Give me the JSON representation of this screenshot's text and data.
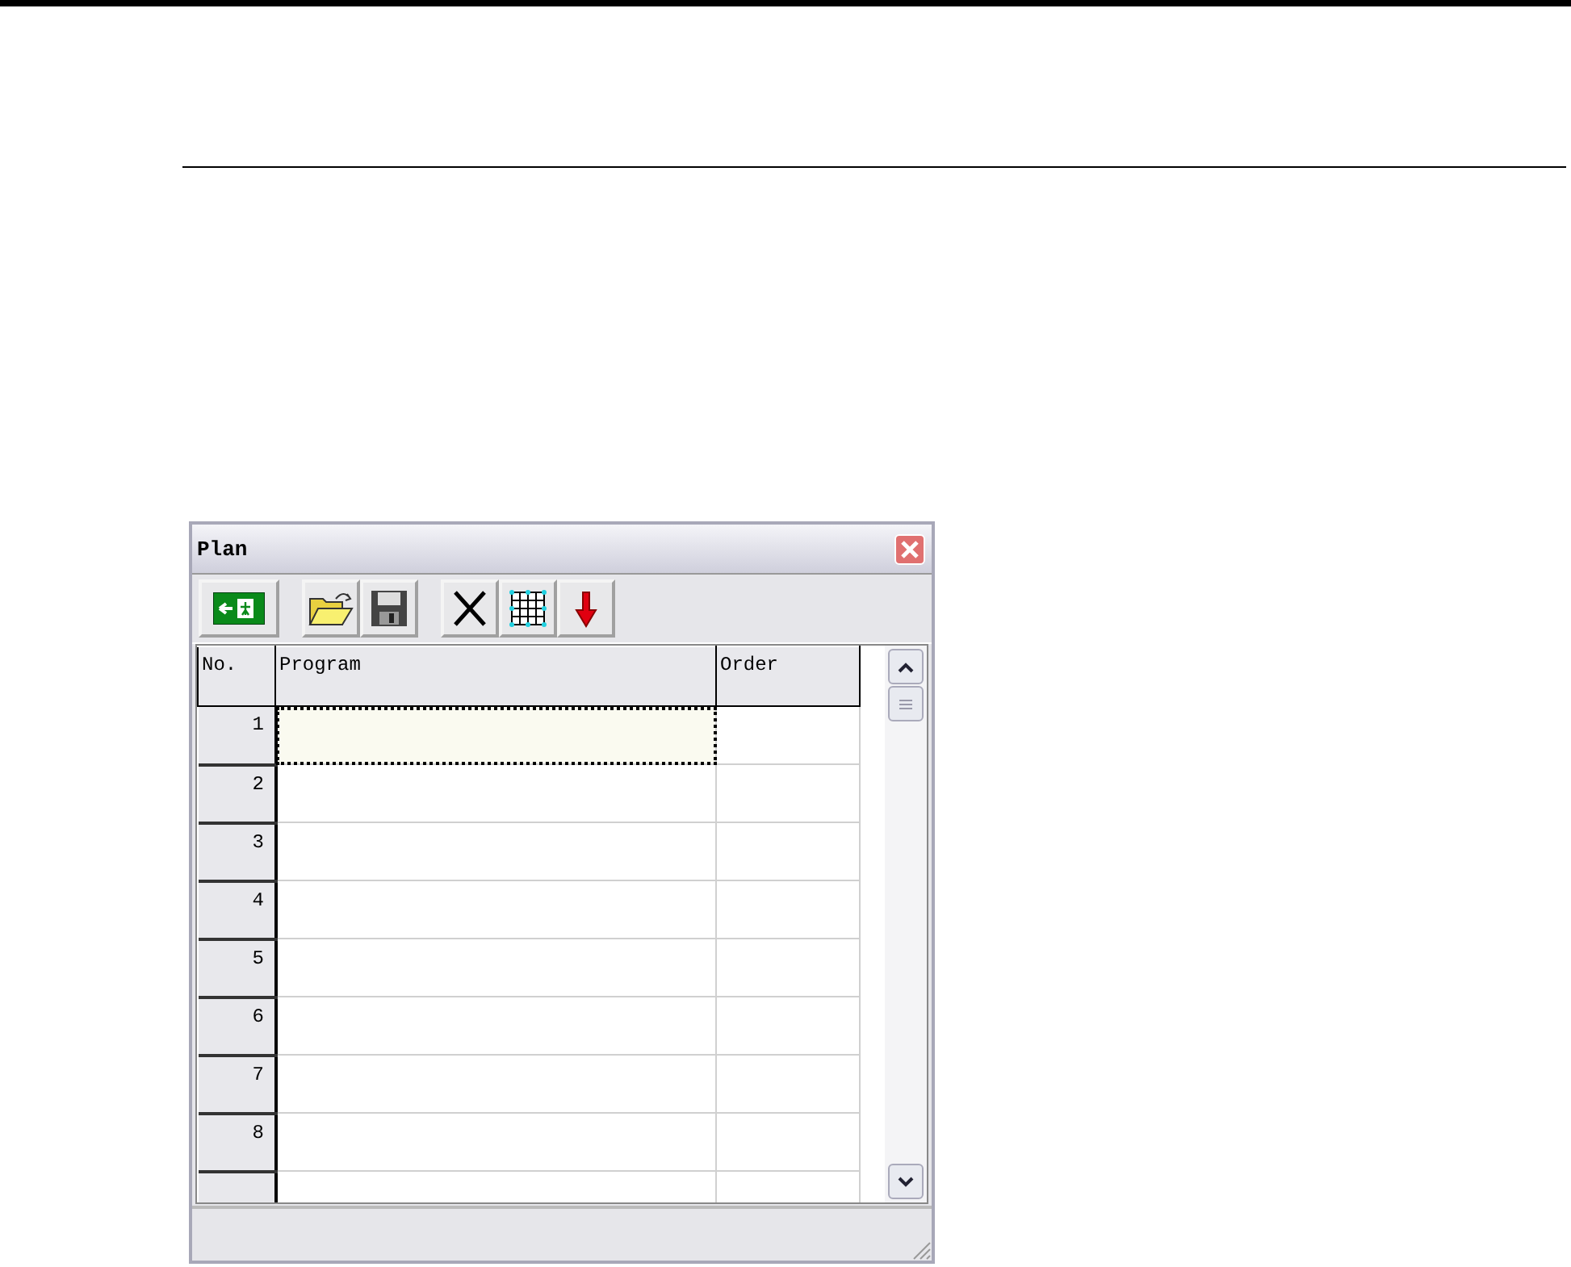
{
  "window": {
    "title": "Plan"
  },
  "table": {
    "columns": [
      "No.",
      "Program",
      "Order"
    ],
    "rows": [
      {
        "number": "1",
        "focused": true
      },
      {
        "number": "2",
        "focused": false
      },
      {
        "number": "3",
        "focused": false
      },
      {
        "number": "4",
        "focused": false
      },
      {
        "number": "5",
        "focused": false
      },
      {
        "number": "6",
        "focused": false
      },
      {
        "number": "7",
        "focused": false
      },
      {
        "number": "8",
        "focused": false
      }
    ]
  }
}
